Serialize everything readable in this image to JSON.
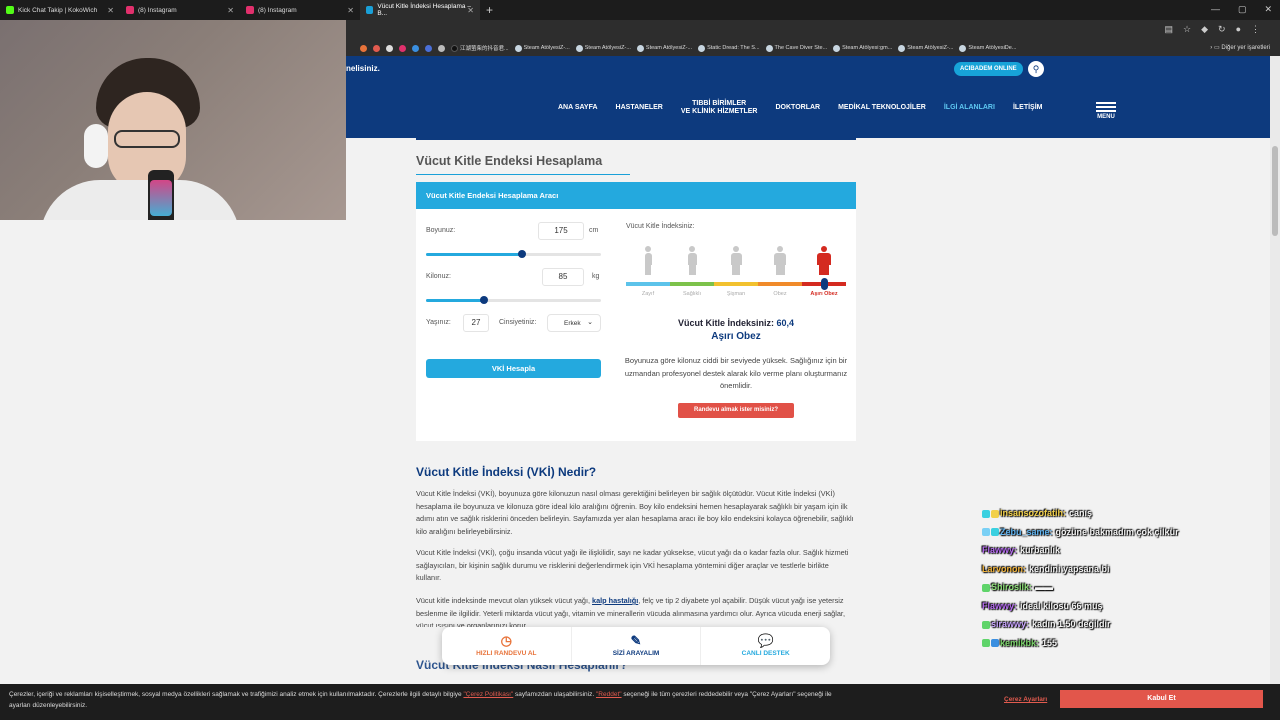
{
  "browser": {
    "tabs": [
      {
        "label": "Kick Chat Takip | KokoWich",
        "color": "#53fc18",
        "active": false
      },
      {
        "label": "(8) Instagram",
        "color": "#e1306c",
        "active": false
      },
      {
        "label": "(8) Instagram",
        "color": "#e1306c",
        "active": false
      },
      {
        "label": "Vücut Kitle İndeksi Hesaplama – B...",
        "color": "#1aa0d8",
        "active": true
      }
    ],
    "bookmarks": [
      "江湖萤柴的抖音君...",
      "Steam AtölyesiZ-...",
      "Steam AtölyesiZ-...",
      "Steam AtölyesiZ-...",
      "Static Dread: The S...",
      "The Cave Diver Ste...",
      "Steam Atölyesi:gm...",
      "Steam AtölyesiZ-...",
      "Steam AtölyesiDe..."
    ],
    "bookmarks_other": "Diğer yer işaretleri"
  },
  "header": {
    "cut_text": "nelisiniz.",
    "brand_btn": "ACIBADEM ONLINE",
    "nav": [
      {
        "l1": "ANA SAYFA",
        "l2": ""
      },
      {
        "l1": "HASTANELER",
        "l2": ""
      },
      {
        "l1": "TIBBİ BİRİMLER",
        "l2": "VE KLİNİK HİZMETLER"
      },
      {
        "l1": "DOKTORLAR",
        "l2": ""
      },
      {
        "l1": "MEDİKAL TEKNOLOJİLER",
        "l2": ""
      },
      {
        "l1": "İLGİ ALANLARI",
        "l2": ""
      },
      {
        "l1": "İLETİŞİM",
        "l2": ""
      }
    ],
    "menu": "MENU"
  },
  "page": {
    "title": "Vücut Kitle Endeksi Hesaplama"
  },
  "calc": {
    "header": "Vücut Kitle Endeksi Hesaplama Aracı",
    "height_label": "Boyunuz:",
    "height_value": "175",
    "height_unit": "cm",
    "height_fraction": 0.55,
    "weight_label": "Kilonuz:",
    "weight_value": "85",
    "weight_unit": "kg",
    "weight_fraction": 0.33,
    "age_label": "Yaşınız:",
    "age_value": "27",
    "gender_label": "Cinsiyetiniz:",
    "gender_value": "Erkek",
    "calc_button": "VKİ Hesapla",
    "index_label": "Vücut Kitle İndeksiniz:",
    "scale": [
      {
        "label": "Zayıf",
        "color": "#5cc3ea"
      },
      {
        "label": "Sağlıklı",
        "color": "#7cc24a"
      },
      {
        "label": "Şişman",
        "color": "#f2c12e"
      },
      {
        "label": "Obez",
        "color": "#f08a2a"
      },
      {
        "label": "Aşırı Obez",
        "color": "#d42a20"
      }
    ],
    "marker_fraction": 0.9,
    "result_label": "Vücut Kitle İndeksiniz:",
    "result_value": "60,4",
    "result_category": "Aşırı Obez",
    "result_text": "Boyunuza göre kilonuz ciddi bir seviyede yüksek. Sağlığınız için bir uzmandan profesyonel destek alarak kilo verme planı oluşturmanız önemlidir.",
    "appointment_button": "Randevu almak ister misiniz?"
  },
  "article": {
    "title": "Vücut Kitle İndeksi (VKİ) Nedir?",
    "p1": "Vücut Kitle İndeksi (VKİ), boyunuza göre kilonuzun nasıl olması gerektiğini belirleyen bir sağlık ölçütüdür. Vücut Kitle İndeksi (VKİ) hesaplama ile boyunuza ve kilonuza göre ideal kilo aralığını öğrenin. Boy kilo endeksini hemen hesaplayarak sağlıklı bir yaşam için ilk adımı atın ve sağlık risklerini önceden belirleyin. Sayfamızda yer alan hesaplama aracı ile boy kilo endeksini kolayca öğrenebilir, sağlıklı kilo aralığını belirleyebilirsiniz.",
    "p2": "Vücut Kitle İndeksi (VKİ), çoğu insanda vücut yağı ile ilişkilidir, sayı ne kadar yüksekse, vücut yağı da o kadar fazla olur. Sağlık hizmeti sağlayıcıları, bir kişinin sağlık durumu ve risklerini değerlendirmek için VKİ hesaplama yöntemini diğer araçlar ve testlerle birlikte kullanır.",
    "p3a": "Vücut kitle indeksinde mevcut olan yüksek vücut yağı,",
    "p3link": "kalp hastalığı",
    "p3b": ", felç ve tip 2 diyabete yol açabilir. Düşük vücut yağı ise yetersiz beslenme ile ilgilidir. Yeterli miktarda vücut yağı, vitamin ve minerallerin vücuda alınmasına yardımcı olur. Ayrıca vücuda enerji sağlar, vücut ısısını ve organlarınızı korur.",
    "title2": "Vücut Kitle İndeksi Nasıl Hesaplanır?"
  },
  "quickbar": [
    {
      "label": "HIZLI RANDEVU AL",
      "color": "#e8733a",
      "icon": "clock-icon"
    },
    {
      "label": "SİZİ ARAYALIM",
      "color": "#0d3a7e",
      "icon": "form-icon"
    },
    {
      "label": "CANLI DESTEK",
      "color": "#24a9de",
      "icon": "chat-icon"
    }
  ],
  "chat": [
    {
      "user": "insansozofatih:",
      "msg": "canış",
      "color": "#f2d04a",
      "badges": [
        "#3ad0e0",
        "#f2d04a"
      ]
    },
    {
      "user": "Zebu_same:",
      "msg": "gözüne bakmadım çok çilkür",
      "color": "#5fb3f0",
      "badges": [
        "#7ad0f5",
        "#3ad0e0"
      ]
    },
    {
      "user": "Flawwy:",
      "msg": "kurbanlık",
      "color": "#b56bf0",
      "badges": []
    },
    {
      "user": "Larvonon:",
      "msg": "kendini yapsana bi",
      "color": "#f0b23a",
      "badges": []
    },
    {
      "user": "Shirosilk:",
      "msg": "▬▬",
      "color": "#8fe07a",
      "badges": [
        "#5fd46a"
      ]
    },
    {
      "user": "Flawwy:",
      "msg": "ideal kilosu 66 muş",
      "color": "#b56bf0",
      "badges": []
    },
    {
      "user": "sirawwy:",
      "msg": "kadın 1.50 değildir",
      "color": "#c9a6ff",
      "badges": [
        "#5fd46a"
      ]
    },
    {
      "user": "kemikbk:",
      "msg": "155",
      "color": "#7bd36b",
      "badges": [
        "#5fd46a",
        "#3a8fe0"
      ]
    }
  ],
  "cookie": {
    "text_a": "Çerezler, içeriği ve reklamları kişiselleştirmek, sosyal medya özellikleri sağlamak ve trafiğimizi analiz etmek için kullanılmaktadır. Çerezlerle ilgili detaylı bilgiye",
    "link1": "\"Çerez Politikası\"",
    "text_b": "sayfamızdan ulaşabilirsiniz.",
    "link2": "\"Reddet\"",
    "text_c": "seçeneği ile tüm çerezleri reddedebilir veya \"Çerez Ayarları\" seçeneği ile ayarları düzenleyebilirsiniz.",
    "settings": "Çerez Ayarları",
    "accept": "Kabul Et"
  }
}
